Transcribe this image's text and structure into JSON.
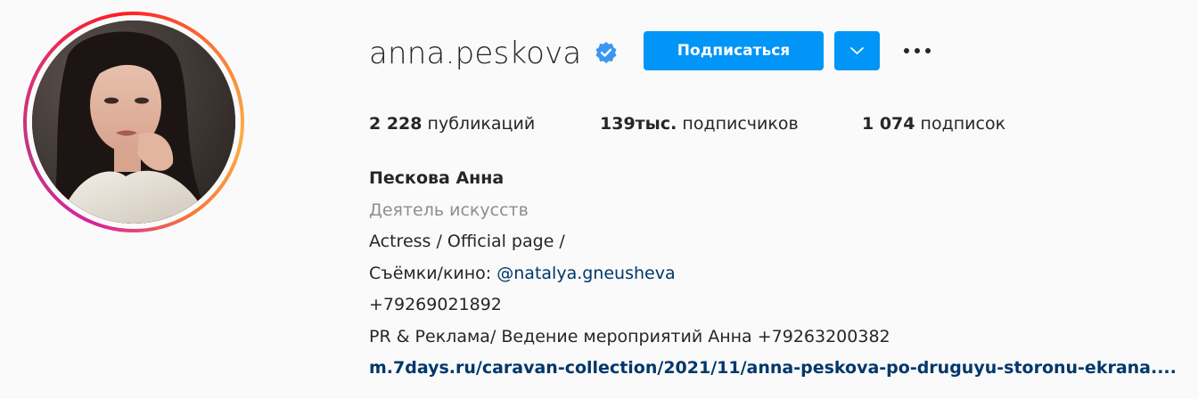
{
  "profile": {
    "username": "anna.peskova",
    "verified": true,
    "follow_label": "Подписаться",
    "more_label": "•••"
  },
  "stats": {
    "posts_count": "2 228",
    "posts_label": "публикаций",
    "followers_count": "139тыс.",
    "followers_label": "подписчиков",
    "following_count": "1 074",
    "following_label": "подписок"
  },
  "bio": {
    "full_name": "Пескова Анна",
    "category": "Деятель искусств",
    "line1": "Actress / Official page /",
    "line2_prefix": "Съёмки/кино: ",
    "line2_mention": "@natalya.gneusheva",
    "line3": "+79269021892",
    "line4": "PR & Реклама/ Ведение мероприятий Анна +79263200382",
    "external_link": "m.7days.ru/caravan-collection/2021/11/anna-peskova-po-druguyu-storonu-ekrana...."
  },
  "colors": {
    "accent": "#0095f6",
    "link": "#00376b",
    "secondary_text": "#8e8e8e",
    "verified_badge": "#3897f0"
  },
  "icons": {
    "verified": "verified-badge-icon",
    "dropdown": "chevron-down-icon",
    "more": "more-options-icon"
  }
}
